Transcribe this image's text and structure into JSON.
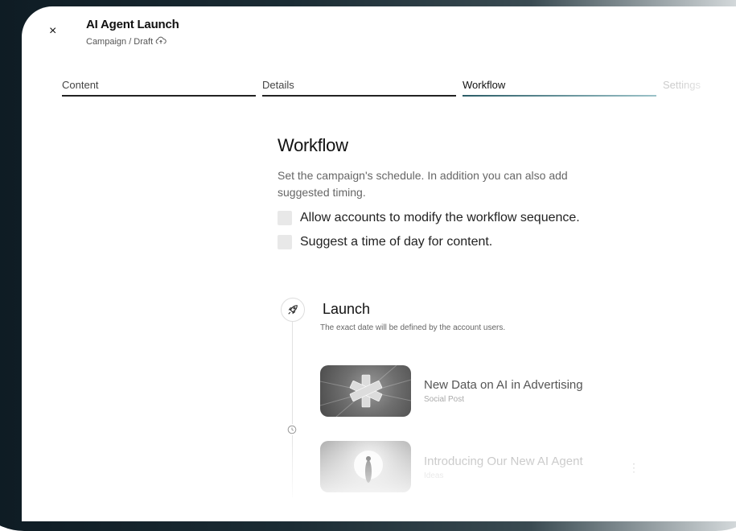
{
  "header": {
    "title": "AI Agent Launch",
    "breadcrumb": "Campaign / Draft",
    "close_icon": "×"
  },
  "tabs": [
    {
      "label": "Content"
    },
    {
      "label": "Details"
    },
    {
      "label": "Workflow",
      "active": true
    },
    {
      "label": "Settings"
    }
  ],
  "main": {
    "heading": "Workflow",
    "description": "Set the campaign's schedule. In addition you can also add suggested timing.",
    "options": [
      {
        "label": "Allow accounts to modify the workflow sequence.",
        "checked": false
      },
      {
        "label": "Suggest a time of day for content.",
        "checked": false
      }
    ]
  },
  "timeline": {
    "stage_title": "Launch",
    "stage_subtitle": "The exact date will be defined by the account users.",
    "items": [
      {
        "title": "New Data on AI in Advertising",
        "type": "Social Post"
      },
      {
        "title": "Introducing Our New AI Agent",
        "type": "Ideas"
      }
    ]
  },
  "colors": {
    "accent": "#2b5c66",
    "text": "#111111",
    "muted": "#666666"
  },
  "icons": [
    "close-icon",
    "cloud-upload-icon",
    "rocket-icon",
    "clock-icon",
    "more-icon"
  ]
}
